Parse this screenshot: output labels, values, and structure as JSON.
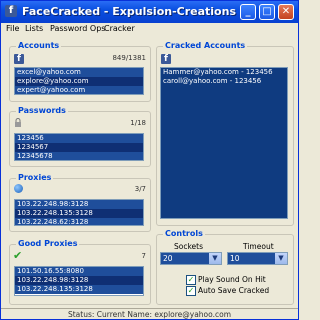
{
  "window": {
    "title": "FaceCracked - Expulsion-Creations",
    "icon": "facebook-icon",
    "min": "_",
    "max": "□",
    "close": "✕"
  },
  "menu": [
    "File",
    "Lists",
    "Password Ops",
    "Cracker"
  ],
  "accounts": {
    "title": "Accounts",
    "count": "849/1381",
    "items": [
      "excel@yahoo.com",
      "explore@yahoo.com",
      "expert@yahoo.com"
    ]
  },
  "passwords": {
    "title": "Passwords",
    "count": "1/18",
    "items": [
      "123456",
      "1234567",
      "12345678"
    ]
  },
  "proxies": {
    "title": "Proxies",
    "count": "3/7",
    "items": [
      "103.22.248.98:3128",
      "103.22.248.135:3128",
      "103.22.248.62:3128"
    ]
  },
  "good_proxies": {
    "title": "Good Proxies",
    "count": "7",
    "items": [
      "101.50.16.55:8080",
      "103.22.248.98:3128",
      "103.22.248.135:3128"
    ]
  },
  "cracked": {
    "title": "Cracked Accounts",
    "items": [
      "Hammer@yahoo.com - 123456",
      "caroll@yahoo.com - 123456"
    ]
  },
  "controls": {
    "title": "Controls",
    "sockets_label": "Sockets",
    "sockets_value": "20",
    "timeout_label": "Timeout",
    "timeout_value": "10",
    "play_sound": "Play Sound On Hit",
    "auto_save": "Auto Save Cracked"
  },
  "status": "Status: Current Name: explore@yahoo.com"
}
